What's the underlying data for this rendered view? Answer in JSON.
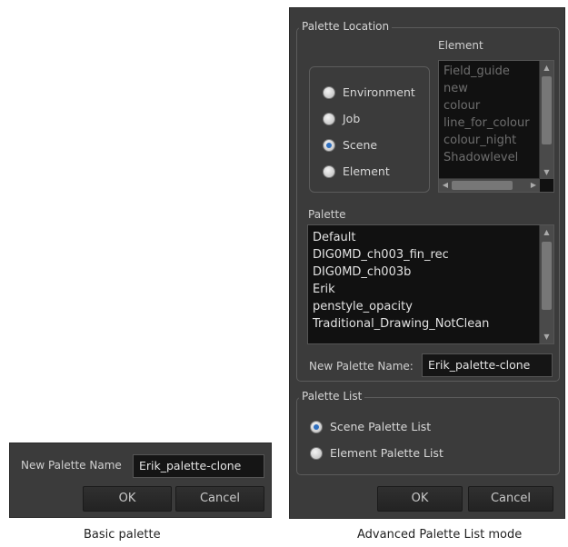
{
  "basic": {
    "name_label": "New Palette Name",
    "name_value": "Erik_palette-clone",
    "ok_label": "OK",
    "cancel_label": "Cancel",
    "caption": "Basic palette"
  },
  "advanced": {
    "location_title": "Palette Location",
    "element_title": "Element",
    "location_options": [
      "Environment",
      "Job",
      "Scene",
      "Element"
    ],
    "location_selected": "Scene",
    "element_items": [
      "Field_guide",
      "new",
      "colour",
      "line_for_colour",
      "colour_night",
      "Shadowlevel"
    ],
    "palette_title": "Palette",
    "palette_items": [
      "Default",
      "DIG0MD_ch003_fin_rec",
      "DIG0MD_ch003b",
      "Erik",
      "penstyle_opacity",
      "Traditional_Drawing_NotClean"
    ],
    "name_label": "New Palette Name:",
    "name_value": "Erik_palette-clone",
    "list_title": "Palette List",
    "list_options": [
      "Scene Palette List",
      "Element Palette List"
    ],
    "list_selected": "Scene Palette List",
    "ok_label": "OK",
    "cancel_label": "Cancel",
    "caption": "Advanced Palette List mode"
  },
  "icons": {
    "scroll_up": "scroll-up-arrow",
    "scroll_down": "scroll-down-arrow",
    "scroll_left": "scroll-left-arrow",
    "scroll_right": "scroll-right-arrow"
  },
  "colors": {
    "panel": "#3b3b3b",
    "list_bg": "#111111",
    "radio_check": "#2e6fbf"
  }
}
